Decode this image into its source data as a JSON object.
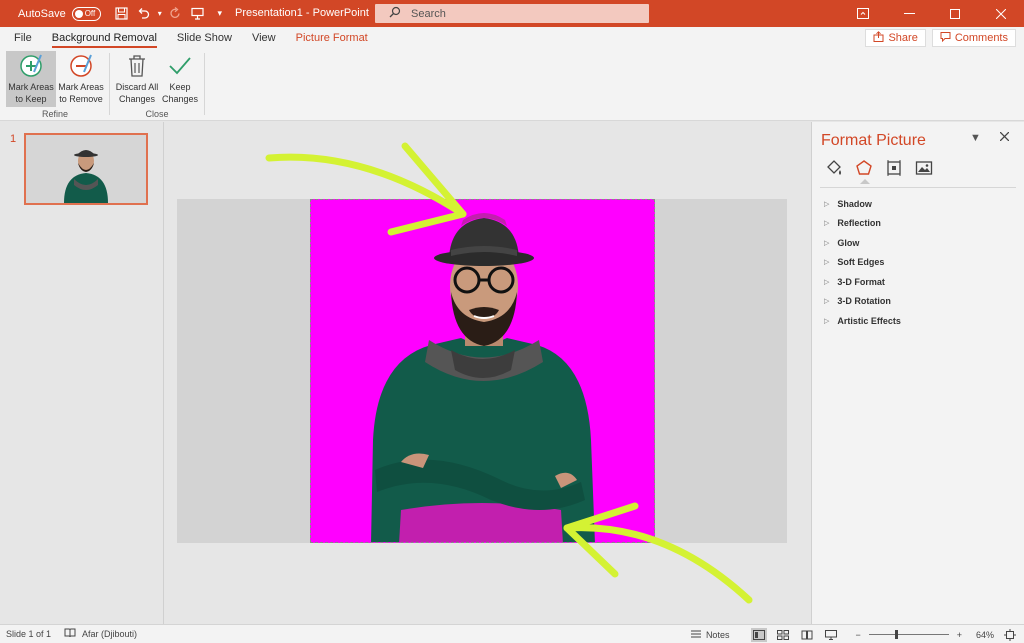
{
  "titlebar": {
    "autosave_label": "AutoSave",
    "autosave_state": "Off",
    "title": "Presentation1  -  PowerPoint",
    "search_placeholder": "Search"
  },
  "tabs": [
    {
      "label": "File"
    },
    {
      "label": "Background Removal"
    },
    {
      "label": "Slide Show"
    },
    {
      "label": "View"
    },
    {
      "label": "Picture Format"
    }
  ],
  "share": {
    "share_label": "Share",
    "comments_label": "Comments"
  },
  "ribbon": {
    "refine": {
      "label": "Refine",
      "mark_keep_1": "Mark Areas",
      "mark_keep_2": "to Keep",
      "mark_remove_1": "Mark Areas",
      "mark_remove_2": "to Remove"
    },
    "close": {
      "label": "Close",
      "discard_1": "Discard All",
      "discard_2": "Changes",
      "keep_1": "Keep",
      "keep_2": "Changes"
    }
  },
  "thumbnails": {
    "slide_number": "1"
  },
  "format_pane": {
    "title": "Format Picture",
    "icons": [
      "fill-line-icon",
      "effects-icon",
      "size-properties-icon",
      "picture-icon"
    ],
    "sections": [
      "Shadow",
      "Reflection",
      "Glow",
      "Soft Edges",
      "3-D Format",
      "3-D Rotation",
      "Artistic Effects"
    ]
  },
  "status": {
    "slide_info": "Slide 1 of 1",
    "language": "Afar (Djibouti)",
    "notes_label": "Notes",
    "zoom_level": "64%"
  },
  "colors": {
    "accent": "#d24726",
    "removal_magenta": "#ff00ff",
    "annotation_arrow": "#d4f233",
    "sweater": "#125b4a"
  }
}
